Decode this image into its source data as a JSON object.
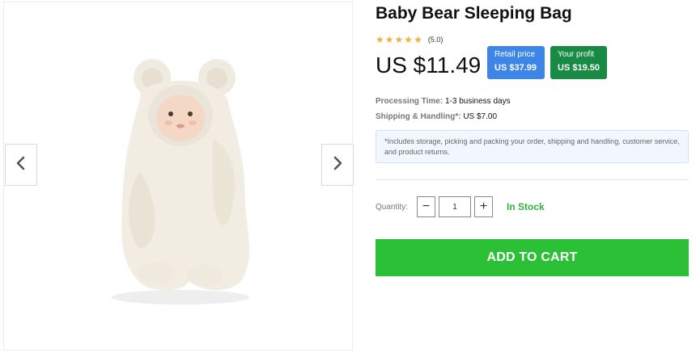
{
  "product": {
    "title": "Baby Bear Sleeping Bag",
    "rating": {
      "stars": 5,
      "value_text": "(5.0)"
    },
    "price": "US $11.49",
    "retail": {
      "label": "Retail price",
      "value": "US $37.99"
    },
    "profit": {
      "label": "Your profit",
      "value": "US $19.50"
    },
    "processing": {
      "label": "Processing Time:",
      "value": "1-3 business days"
    },
    "shipping": {
      "label": "Shipping & Handling*:",
      "value": "US $7.00"
    },
    "note": "*Includes storage, picking and packing your order, shipping and handling, customer service, and product returns.",
    "quantity": {
      "label": "Quantity:",
      "value": "1",
      "minus": "−",
      "plus": "+"
    },
    "stock_status": "In Stock",
    "add_to_cart": "ADD TO CART"
  },
  "gallery": {
    "prev_icon": "chevron-left-icon",
    "next_icon": "chevron-right-icon",
    "image": "baby-in-bear-sleeping-bag"
  },
  "colors": {
    "retail_badge": "#3d86e8",
    "profit_badge": "#188a43",
    "add_to_cart": "#2cc036",
    "in_stock": "#33b33a",
    "star": "#f4b13a"
  }
}
